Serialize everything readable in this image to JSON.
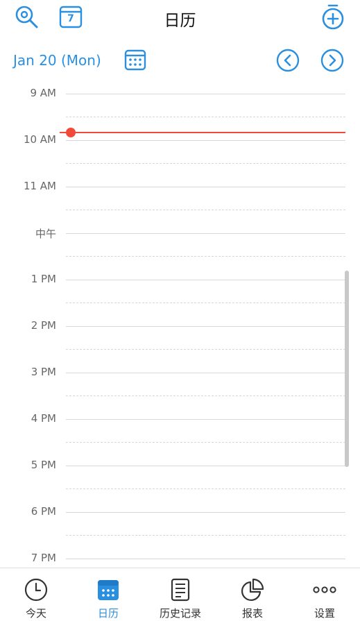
{
  "header": {
    "title": "日历"
  },
  "date_bar": {
    "label": "Jan 20 (Mon)",
    "calendar_day": "7"
  },
  "timeline": {
    "hours": [
      "9 AM",
      "10 AM",
      "11 AM",
      "中午",
      "1 PM",
      "2 PM",
      "3 PM",
      "4 PM",
      "5 PM",
      "6 PM",
      "7 PM"
    ]
  },
  "tabbar": {
    "tabs": [
      {
        "label": "今天",
        "icon": "clock-icon",
        "active": false
      },
      {
        "label": "日历",
        "icon": "calendar-icon",
        "active": true
      },
      {
        "label": "历史记录",
        "icon": "document-list-icon",
        "active": false
      },
      {
        "label": "报表",
        "icon": "pie-chart-icon",
        "active": false
      },
      {
        "label": "设置",
        "icon": "more-icon",
        "active": false
      }
    ]
  },
  "colors": {
    "accent": "#2b8fe0",
    "now_line": "#f24a3a",
    "text": "#222222"
  }
}
